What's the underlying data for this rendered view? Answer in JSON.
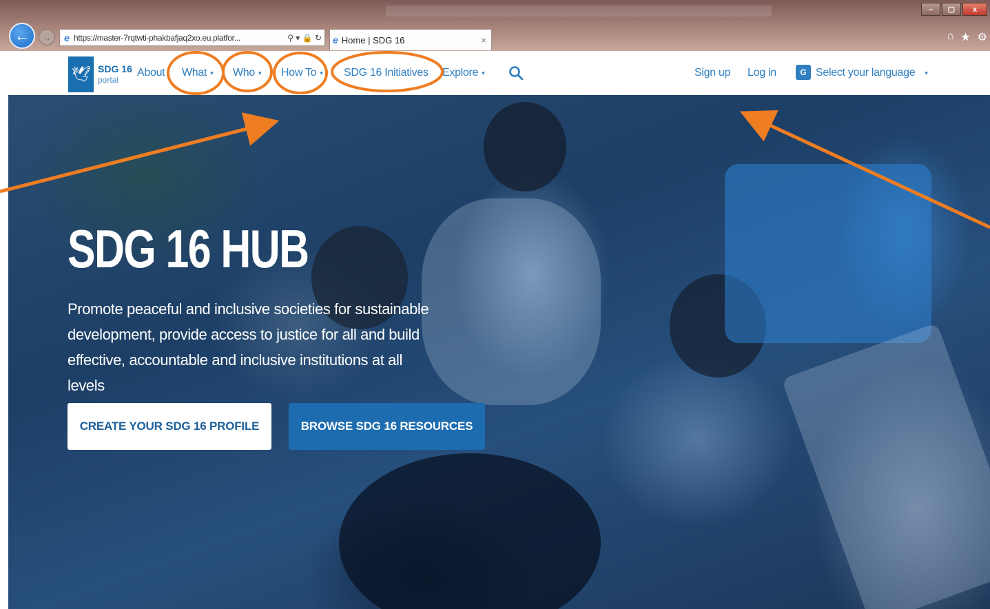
{
  "browser": {
    "address": "https://master-7rqtwti-phakbafjaq2xo.eu.platfor...",
    "address_tools": "⚲ ▾ 🔒 ↻",
    "tab_label": "Home | SDG 16",
    "tab_close": "×",
    "back": "←",
    "forward": "→",
    "window_buttons": {
      "minimize": "–",
      "maximize": "▢",
      "close": "x"
    },
    "home": "⌂",
    "favorites": "★"
  },
  "site": {
    "logo": {
      "title": "SDG 16",
      "subtitle": "portal"
    },
    "nav": [
      {
        "label": "About",
        "caret": ""
      },
      {
        "label": "What",
        "caret": "▾"
      },
      {
        "label": "Who",
        "caret": "▾"
      },
      {
        "label": "How To",
        "caret": "▾"
      },
      {
        "label": "SDG 16 Initiatives",
        "caret": ""
      },
      {
        "label": "Explore",
        "caret": "▾"
      }
    ],
    "sign_up": "Sign up",
    "log_in": "Log in",
    "language": {
      "label": "Select your language",
      "caret": "▾",
      "icon_glyph": "G"
    }
  },
  "hero": {
    "title": "SDG 16 HUB",
    "description": "Promote peaceful and inclusive societies for sustainable development, provide access to justice for all and build effective, accountable and inclusive institutions at all levels",
    "create_button": "CREATE YOUR SDG 16 PROFILE",
    "browse_button": "BROWSE SDG 16 RESOURCES"
  },
  "annotation": {
    "color": "#ef7d22"
  }
}
